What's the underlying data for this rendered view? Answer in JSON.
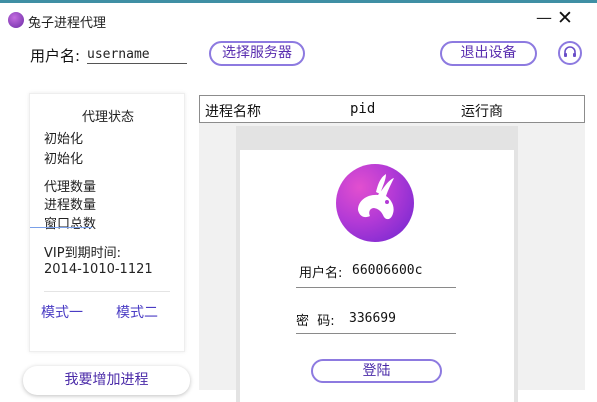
{
  "window": {
    "title": "兔子进程代理",
    "minimize_glyph": "—",
    "close_glyph": "✕"
  },
  "header": {
    "user_label": "用户名:",
    "user_value": "username",
    "select_server_label": "选择服务器",
    "logout_device_label": "退出设备",
    "support_icon": "headset-icon"
  },
  "status": {
    "title": "代理状态",
    "line1": "初始化",
    "line2": "初始化",
    "proxy_count_label": "代理数量",
    "process_count_label": "进程数量",
    "window_total_label": "窗口总数",
    "vip_label": "VIP到期时间:",
    "vip_value": "2014-1010-1121",
    "mode1": "模式一",
    "mode2": "模式二"
  },
  "add_process_label": "我要增加进程",
  "table": {
    "columns": [
      "进程名称",
      "pid",
      "运行商"
    ]
  },
  "login": {
    "logo_icon": "rabbit-icon",
    "username_label": "用户名:",
    "username_value": "66006600c",
    "password_label": "密  码:",
    "password_value": "336699",
    "login_button": "登陆"
  },
  "colors": {
    "accent": "#8d7ae0",
    "text_accent": "#4a2aa8",
    "logo_start": "#e24fcf",
    "logo_end": "#6a25d0"
  }
}
